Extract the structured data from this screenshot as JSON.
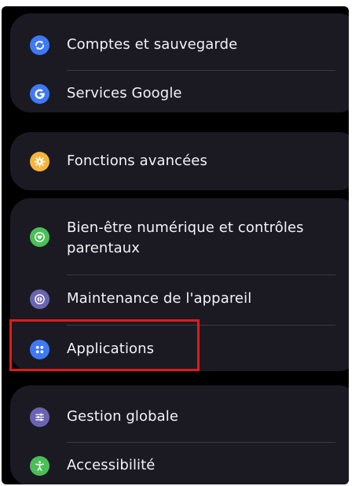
{
  "settings": {
    "groups": [
      {
        "items": [
          {
            "label": "Comptes et sauvegarde",
            "icon": "sync-icon",
            "icon_color": "#3e79f6"
          },
          {
            "label": "Services Google",
            "icon": "google-g-icon",
            "icon_color": "#3e79f6"
          }
        ]
      },
      {
        "items": [
          {
            "label": "Fonctions avancées",
            "icon": "gear-plus-icon",
            "icon_color": "#f8b43c"
          }
        ]
      },
      {
        "items": [
          {
            "label": "Bien-être numérique et contrôles parentaux",
            "icon": "heart-circle-icon",
            "icon_color": "#4bbf57"
          },
          {
            "label": "Maintenance de l'appareil",
            "icon": "device-care-icon",
            "icon_color": "#6b64b2"
          },
          {
            "label": "Applications",
            "icon": "apps-grid-icon",
            "icon_color": "#3e79f6"
          }
        ]
      },
      {
        "items": [
          {
            "label": "Gestion globale",
            "icon": "sliders-icon",
            "icon_color": "#6b64b2"
          },
          {
            "label": "Accessibilité",
            "icon": "accessibility-person-icon",
            "icon_color": "#4bbf57"
          }
        ]
      }
    ]
  },
  "highlight": {
    "target": "Applications",
    "color": "#e01a1a"
  }
}
